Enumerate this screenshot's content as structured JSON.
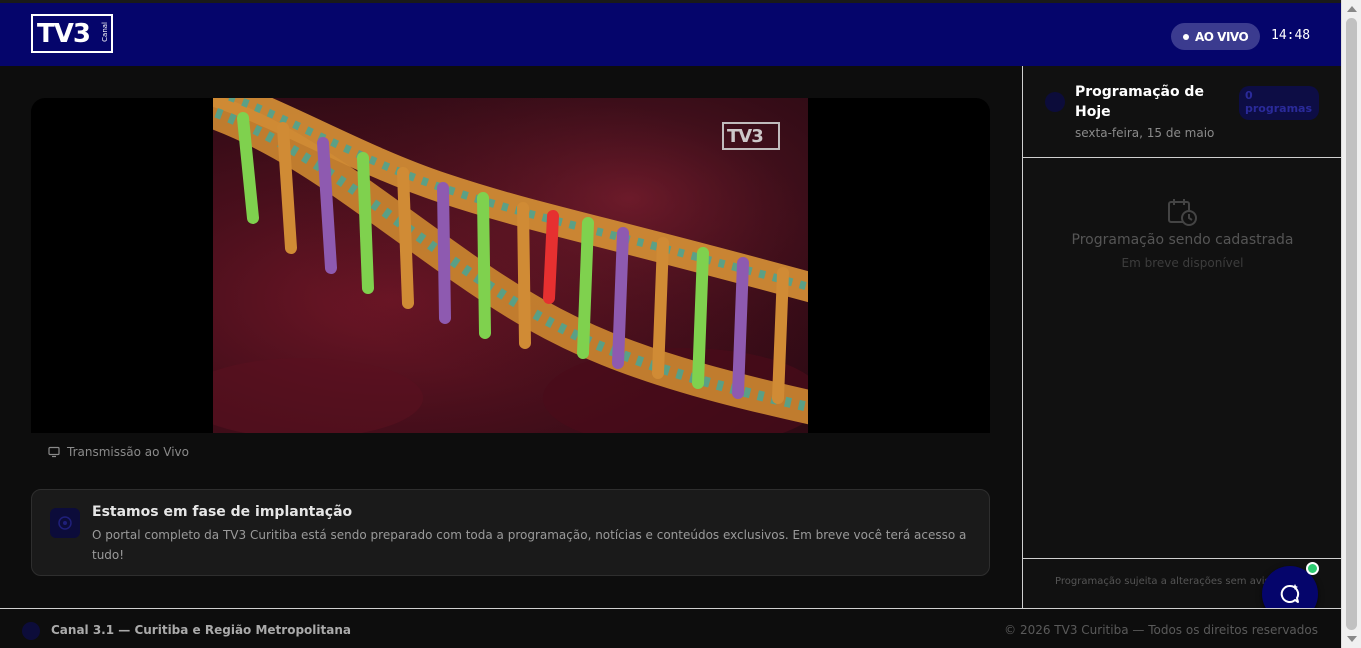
{
  "header": {
    "logo_text": "TV3",
    "logo_sub": "Canal",
    "live_label": "AO VIVO",
    "clock": "14:48"
  },
  "player": {
    "overlay_logo": "TV3",
    "stream_label": "Transmissão ao Vivo"
  },
  "notice": {
    "title": "Estamos em fase de implantação",
    "text": "O portal completo da TV3 Curitiba está sendo preparado com toda a programação, notícias e conteúdos exclusivos. Em breve você terá acesso a tudo!"
  },
  "schedule": {
    "title": "Programação de Hoje",
    "date": "sexta-feira, 15 de maio",
    "pill": "0 programas",
    "empty_title": "Programação sendo cadastrada",
    "empty_sub": "Em breve disponível",
    "footnote": "Programação sujeita a alterações sem aviso prévio"
  },
  "footer": {
    "channel": "Canal 3.1 — Curitiba e Região Metropolitana",
    "copyright": "© 2026 TV3 Curitiba — Todos os direitos reservados"
  },
  "icons": {
    "stream": "monitor-icon",
    "notice": "info-icon",
    "schedule": "calendar-clock-icon",
    "chat": "chat-sparkle-icon"
  },
  "colors": {
    "header_bg": "#05056b",
    "live_badge_bg": "#3b3b8f",
    "online_dot": "#2ecc71"
  }
}
